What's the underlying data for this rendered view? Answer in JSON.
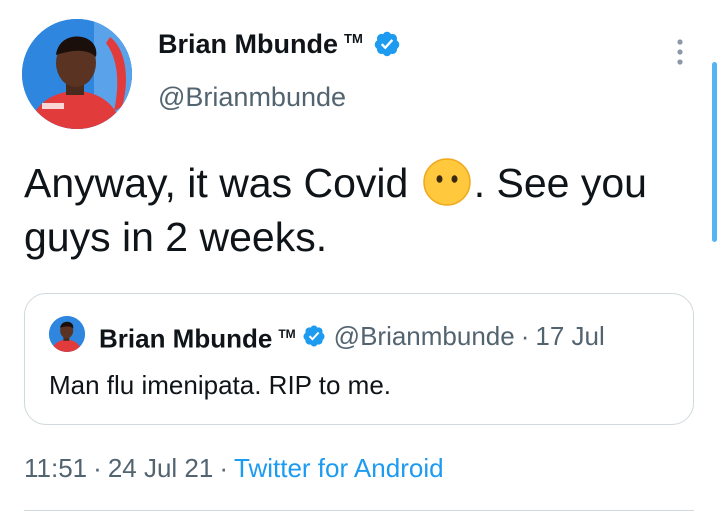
{
  "author": {
    "display_name": "Brian Mbunde",
    "trademark": "TM",
    "handle": "@Brianmbunde",
    "verified": true
  },
  "tweet": {
    "text_before_emoji": "Anyway, it was Covid ",
    "emoji": "face-without-mouth-emoji",
    "text_after_emoji": ". See you guys in 2 weeks."
  },
  "quoted_tweet": {
    "display_name": "Brian Mbunde",
    "trademark": "TM",
    "handle": "@Brianmbunde",
    "separator": "·",
    "date": "17 Jul",
    "text": "Man flu imenipata. RIP to me."
  },
  "meta": {
    "time": "11:51",
    "separator": "·",
    "date": "24 Jul 21",
    "source": "Twitter for Android"
  },
  "colors": {
    "text_primary": "#0f1419",
    "text_secondary": "#536471",
    "accent": "#1d9bf0",
    "border": "#cfd9de"
  }
}
